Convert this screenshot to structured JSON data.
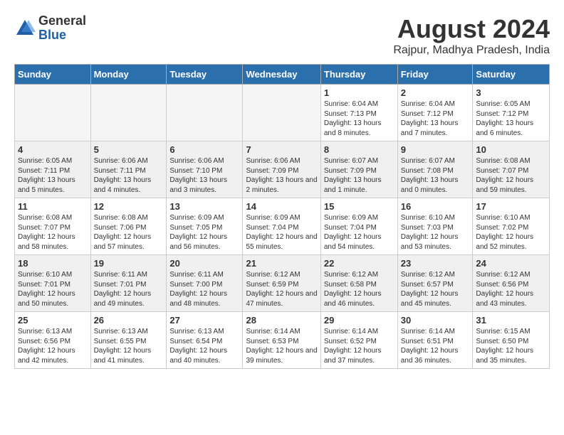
{
  "header": {
    "logo_general": "General",
    "logo_blue": "Blue",
    "month_title": "August 2024",
    "location": "Rajpur, Madhya Pradesh, India"
  },
  "weekdays": [
    "Sunday",
    "Monday",
    "Tuesday",
    "Wednesday",
    "Thursday",
    "Friday",
    "Saturday"
  ],
  "weeks": [
    [
      {
        "day": "",
        "sunrise": "",
        "sunset": "",
        "daylight": "",
        "empty": true
      },
      {
        "day": "",
        "sunrise": "",
        "sunset": "",
        "daylight": "",
        "empty": true
      },
      {
        "day": "",
        "sunrise": "",
        "sunset": "",
        "daylight": "",
        "empty": true
      },
      {
        "day": "",
        "sunrise": "",
        "sunset": "",
        "daylight": "",
        "empty": true
      },
      {
        "day": "1",
        "sunrise": "Sunrise: 6:04 AM",
        "sunset": "Sunset: 7:13 PM",
        "daylight": "Daylight: 13 hours and 8 minutes."
      },
      {
        "day": "2",
        "sunrise": "Sunrise: 6:04 AM",
        "sunset": "Sunset: 7:12 PM",
        "daylight": "Daylight: 13 hours and 7 minutes."
      },
      {
        "day": "3",
        "sunrise": "Sunrise: 6:05 AM",
        "sunset": "Sunset: 7:12 PM",
        "daylight": "Daylight: 13 hours and 6 minutes."
      }
    ],
    [
      {
        "day": "4",
        "sunrise": "Sunrise: 6:05 AM",
        "sunset": "Sunset: 7:11 PM",
        "daylight": "Daylight: 13 hours and 5 minutes."
      },
      {
        "day": "5",
        "sunrise": "Sunrise: 6:06 AM",
        "sunset": "Sunset: 7:11 PM",
        "daylight": "Daylight: 13 hours and 4 minutes."
      },
      {
        "day": "6",
        "sunrise": "Sunrise: 6:06 AM",
        "sunset": "Sunset: 7:10 PM",
        "daylight": "Daylight: 13 hours and 3 minutes."
      },
      {
        "day": "7",
        "sunrise": "Sunrise: 6:06 AM",
        "sunset": "Sunset: 7:09 PM",
        "daylight": "Daylight: 13 hours and 2 minutes."
      },
      {
        "day": "8",
        "sunrise": "Sunrise: 6:07 AM",
        "sunset": "Sunset: 7:09 PM",
        "daylight": "Daylight: 13 hours and 1 minute."
      },
      {
        "day": "9",
        "sunrise": "Sunrise: 6:07 AM",
        "sunset": "Sunset: 7:08 PM",
        "daylight": "Daylight: 13 hours and 0 minutes."
      },
      {
        "day": "10",
        "sunrise": "Sunrise: 6:08 AM",
        "sunset": "Sunset: 7:07 PM",
        "daylight": "Daylight: 12 hours and 59 minutes."
      }
    ],
    [
      {
        "day": "11",
        "sunrise": "Sunrise: 6:08 AM",
        "sunset": "Sunset: 7:07 PM",
        "daylight": "Daylight: 12 hours and 58 minutes."
      },
      {
        "day": "12",
        "sunrise": "Sunrise: 6:08 AM",
        "sunset": "Sunset: 7:06 PM",
        "daylight": "Daylight: 12 hours and 57 minutes."
      },
      {
        "day": "13",
        "sunrise": "Sunrise: 6:09 AM",
        "sunset": "Sunset: 7:05 PM",
        "daylight": "Daylight: 12 hours and 56 minutes."
      },
      {
        "day": "14",
        "sunrise": "Sunrise: 6:09 AM",
        "sunset": "Sunset: 7:04 PM",
        "daylight": "Daylight: 12 hours and 55 minutes."
      },
      {
        "day": "15",
        "sunrise": "Sunrise: 6:09 AM",
        "sunset": "Sunset: 7:04 PM",
        "daylight": "Daylight: 12 hours and 54 minutes."
      },
      {
        "day": "16",
        "sunrise": "Sunrise: 6:10 AM",
        "sunset": "Sunset: 7:03 PM",
        "daylight": "Daylight: 12 hours and 53 minutes."
      },
      {
        "day": "17",
        "sunrise": "Sunrise: 6:10 AM",
        "sunset": "Sunset: 7:02 PM",
        "daylight": "Daylight: 12 hours and 52 minutes."
      }
    ],
    [
      {
        "day": "18",
        "sunrise": "Sunrise: 6:10 AM",
        "sunset": "Sunset: 7:01 PM",
        "daylight": "Daylight: 12 hours and 50 minutes."
      },
      {
        "day": "19",
        "sunrise": "Sunrise: 6:11 AM",
        "sunset": "Sunset: 7:01 PM",
        "daylight": "Daylight: 12 hours and 49 minutes."
      },
      {
        "day": "20",
        "sunrise": "Sunrise: 6:11 AM",
        "sunset": "Sunset: 7:00 PM",
        "daylight": "Daylight: 12 hours and 48 minutes."
      },
      {
        "day": "21",
        "sunrise": "Sunrise: 6:12 AM",
        "sunset": "Sunset: 6:59 PM",
        "daylight": "Daylight: 12 hours and 47 minutes."
      },
      {
        "day": "22",
        "sunrise": "Sunrise: 6:12 AM",
        "sunset": "Sunset: 6:58 PM",
        "daylight": "Daylight: 12 hours and 46 minutes."
      },
      {
        "day": "23",
        "sunrise": "Sunrise: 6:12 AM",
        "sunset": "Sunset: 6:57 PM",
        "daylight": "Daylight: 12 hours and 45 minutes."
      },
      {
        "day": "24",
        "sunrise": "Sunrise: 6:12 AM",
        "sunset": "Sunset: 6:56 PM",
        "daylight": "Daylight: 12 hours and 43 minutes."
      }
    ],
    [
      {
        "day": "25",
        "sunrise": "Sunrise: 6:13 AM",
        "sunset": "Sunset: 6:56 PM",
        "daylight": "Daylight: 12 hours and 42 minutes."
      },
      {
        "day": "26",
        "sunrise": "Sunrise: 6:13 AM",
        "sunset": "Sunset: 6:55 PM",
        "daylight": "Daylight: 12 hours and 41 minutes."
      },
      {
        "day": "27",
        "sunrise": "Sunrise: 6:13 AM",
        "sunset": "Sunset: 6:54 PM",
        "daylight": "Daylight: 12 hours and 40 minutes."
      },
      {
        "day": "28",
        "sunrise": "Sunrise: 6:14 AM",
        "sunset": "Sunset: 6:53 PM",
        "daylight": "Daylight: 12 hours and 39 minutes."
      },
      {
        "day": "29",
        "sunrise": "Sunrise: 6:14 AM",
        "sunset": "Sunset: 6:52 PM",
        "daylight": "Daylight: 12 hours and 37 minutes."
      },
      {
        "day": "30",
        "sunrise": "Sunrise: 6:14 AM",
        "sunset": "Sunset: 6:51 PM",
        "daylight": "Daylight: 12 hours and 36 minutes."
      },
      {
        "day": "31",
        "sunrise": "Sunrise: 6:15 AM",
        "sunset": "Sunset: 6:50 PM",
        "daylight": "Daylight: 12 hours and 35 minutes."
      }
    ]
  ]
}
